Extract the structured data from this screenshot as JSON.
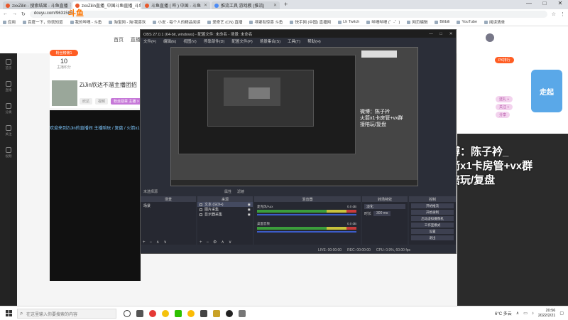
{
  "browser": {
    "tabs": [
      {
        "label": "zxxZilin - 搜索结果 - 斗鱼直播"
      },
      {
        "label": "zxxZilin直播_中国斗鱼直播_斗鱼",
        "active": true
      },
      {
        "label": "斗鱼直播 ( 哔 ) 中国 - 斗鱼"
      },
      {
        "label": "推流工具 游戏教 (推流)"
      }
    ],
    "new_tab": "+",
    "url": "douyu.com/9631589",
    "bookmarks": [
      "应用",
      "百度一下，你就知道",
      "我的哔哩 - 斗鱼",
      "淘宝网 - 淘!我喜欢",
      "小说 - 每个人的精品阅读",
      "爱奇艺 (CN) 直播",
      "寻聚有惊喜 斗鱼",
      "快手网 (中国) 直播网",
      "Lh Twitch",
      "哔哩哔哩 (゜-゜)",
      "网页编辑",
      "Bilibili",
      "YouTube",
      "阅读清单"
    ],
    "window_controls": [
      "—",
      "□",
      "✕"
    ]
  },
  "site": {
    "logo": "斗鱼",
    "nav": [
      "首页",
      "直播"
    ],
    "sidebar_items": [
      "首页",
      "直播",
      "分类",
      "关注",
      "视频"
    ],
    "fans": {
      "badge": "粉丝榜第1",
      "count": "10",
      "label": "主播积分"
    },
    "room_title": "ZiJin欣达不溜主播团招",
    "room_tags": [
      "欣达",
      "视频",
      "粉丝勋章 主播 >"
    ],
    "marquee": "欢迎来到ZiJin的直播间 主播陪玩 / 复盘 / 火箭x1卡房管",
    "rank_badge": "PK排行",
    "pink_buttons": [
      "送礼 +",
      "关注 +",
      "分享"
    ],
    "promo": "走起",
    "overlay_lines": [
      "微博：陈子衿_",
      "火箭x1卡房管+vx群",
      "接陪玩/复盘"
    ]
  },
  "obs": {
    "title": "OBS 27.0.1 (64-bit, windows) - 配置文件: 未命名 - 场景: 未命名",
    "menu": [
      "文件(F)",
      "编辑(E)",
      "视图(V)",
      "停靠部件(D)",
      "配置文件(P)",
      "场景集合(S)",
      "工具(T)",
      "帮助(H)"
    ],
    "preview_text": [
      "微博：陈子衿",
      "火箭x1卡房管+vx群",
      "接陪玩/复盘"
    ],
    "panels": {
      "scenes_header": "场景",
      "sources_header": "来源",
      "mixer_header": "混音器",
      "transitions_header": "转场特效",
      "controls_header": "控制"
    },
    "scene_name": "场景",
    "sources": [
      {
        "label": "文本 (GDI+)",
        "selected": true
      },
      {
        "label": "图片采集"
      },
      {
        "label": "显示器采集"
      }
    ],
    "mixer": [
      {
        "name": "桌面音频",
        "db": "0.0 dB"
      },
      {
        "name": "麦克风/Aux",
        "db": "0.0 dB"
      }
    ],
    "transition": {
      "type": "淡化",
      "duration_label": "时长",
      "duration": "300 ms"
    },
    "controls": [
      "开始推流",
      "开始录制",
      "启动虚拟摄像机",
      "工作室模式",
      "设置",
      "退出"
    ],
    "status": [
      "LIVE: 00:00:00",
      "REC: 00:00:00",
      "CPU: 0.9%, 60.00 fps"
    ],
    "source_filter_label": "未选择源",
    "properties_label": "属性",
    "filters_label": "滤镜"
  },
  "taskbar": {
    "search_placeholder": "在这里输入你要搜索的内容",
    "weather": "6°C 多云",
    "time": "20:56",
    "date": "2022/2/21"
  }
}
